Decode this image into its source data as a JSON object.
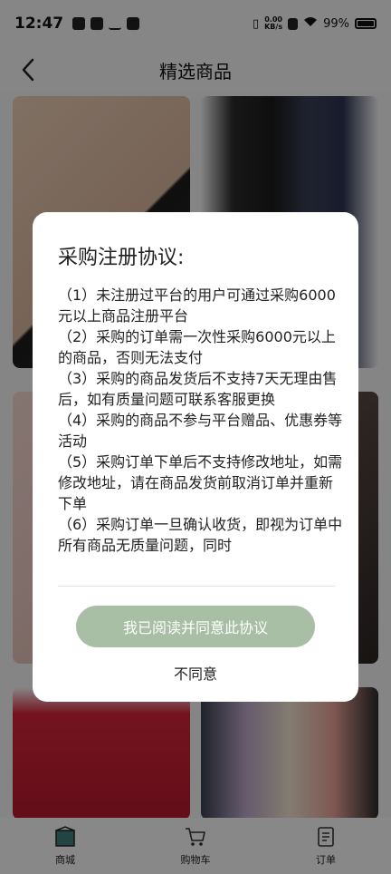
{
  "status_bar": {
    "time": "12:47",
    "net_speed_value": "0.00",
    "net_speed_unit": "KB/s",
    "battery": "99%"
  },
  "header": {
    "title": "精选商品",
    "back_icon": "chevron-left-icon"
  },
  "bottom_nav": {
    "items": [
      {
        "label": "商城",
        "icon": "store-icon",
        "active": true
      },
      {
        "label": "购物车",
        "icon": "cart-icon",
        "active": false
      },
      {
        "label": "订单",
        "icon": "order-icon",
        "active": false
      }
    ]
  },
  "modal": {
    "title": "采购注册协议:",
    "terms": [
      "（1）未注册过平台的用户可通过采购6000元以上商品注册平台",
      "（2）采购的订单需一次性采购6000元以上的商品，否则无法支付",
      "（3）采购的商品发货后不支持7天无理由售后，如有质量问题可联系客服更换",
      "（4）采购的商品不参与平台赠品、优惠券等活动",
      "（5）采购订单下单后不支持修改地址，如需修改地址，请在商品发货前取消订单并重新下单",
      "（6）采购订单一旦确认收货，即视为订单中所有商品无质量问题，同时"
    ],
    "agree_label": "我已阅读并同意此协议",
    "disagree_label": "不同意"
  },
  "colors": {
    "accent_button": "#a8bfa6",
    "overlay": "rgba(0,0,0,0.45)"
  }
}
